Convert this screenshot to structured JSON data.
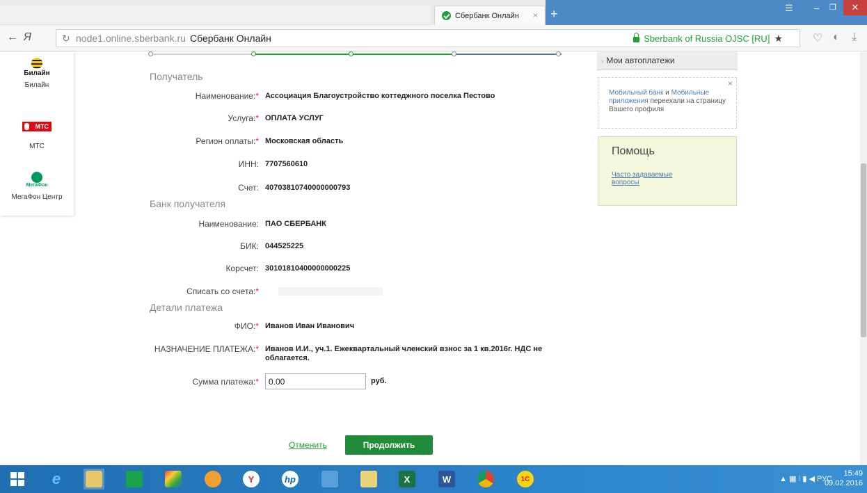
{
  "browser": {
    "tab_title": "Сбербанк Онлайн",
    "tab_close": "×",
    "new_tab": "+",
    "logo_letter": "Я",
    "url_host": "node1.online.sberbank.ru",
    "url_title": "Сбербанк Онлайн",
    "certificate": "Sberbank of Russia OJSC [RU]"
  },
  "sidebar": {
    "providers": [
      {
        "logo_text": "Билайн",
        "name": "Билайн"
      },
      {
        "logo_text": "МТС",
        "name": "МТС"
      },
      {
        "logo_text": "МегаФон",
        "name": "МегаФон Центр"
      }
    ]
  },
  "form": {
    "recipient": {
      "title": "Получатель",
      "name_label": "Наименование:",
      "name_value": "Ассоциация Благоустройство коттеджного поселка Пестово",
      "service_label": "Услуга:",
      "service_value": "ОПЛАТА УСЛУГ",
      "region_label": "Регион оплаты:",
      "region_value": "Московская область",
      "inn_label": "ИНН:",
      "inn_value": "7707560610",
      "account_label": "Счет:",
      "account_value": "40703810740000000793"
    },
    "bank": {
      "title": "Банк получателя",
      "name_label": "Наименование:",
      "name_value": "ПАО СБЕРБАНК",
      "bik_label": "БИК:",
      "bik_value": "044525225",
      "corr_label": "Корсчет:",
      "corr_value": "30101810400000000225",
      "debit_label": "Списать со счета:"
    },
    "details": {
      "title": "Детали платежа",
      "fio_label": "ФИО:",
      "fio_value": "Иванов Иван Иванович",
      "purpose_label": "НАЗНАЧЕНИЕ ПЛАТЕЖА:",
      "purpose_value_line1": "Иванов И.И., уч.1. Ежеквартальный членский взнос за 1 кв.2016г. НДС не",
      "purpose_value_line2": "облагается.",
      "amount_label": "Сумма платежа:",
      "amount_value": "0.00",
      "currency": "руб."
    },
    "required_mark": "*",
    "cancel": "Отменить",
    "continue": "Продолжить"
  },
  "right_panel": {
    "autopay": "Мои автоплатежи",
    "notice": {
      "link1": "Мобильный банк",
      "and": " и ",
      "link2": "Мобильные приложения",
      "text": " переехали на страницу Вашего профиля"
    },
    "help_title": "Помощь",
    "help_link": "Часто задаваемые вопросы"
  },
  "taskbar": {
    "language": "РУС",
    "time": "15:49",
    "date": "09.02.2016"
  },
  "colors": {
    "sber_green": "#21a038",
    "button_green": "#218d3a",
    "required_red": "#d9252a",
    "link_blue": "#4a7db4"
  }
}
